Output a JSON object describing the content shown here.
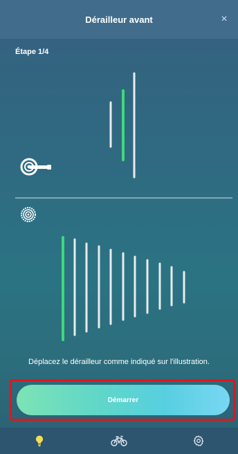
{
  "header": {
    "title": "Dérailleur avant",
    "close_glyph": "×"
  },
  "step": {
    "label": "Étape 1/4"
  },
  "illustration": {
    "crank_icon": "crankset-icon",
    "cassette_icon": "cassette-icon",
    "front_chainrings": 3,
    "front_active": 2,
    "rear_sprockets": 11,
    "rear_active": 1,
    "colors": {
      "active": "#3fd97a",
      "inactive": "#e9ecef",
      "divider": "#d7e2ea"
    }
  },
  "instruction": {
    "text": "Déplacez le dérailleur comme indiqué sur l'illustration."
  },
  "start_button": {
    "label": "Démarrer",
    "highlight_color": "#e0161e"
  },
  "tabbar": {
    "tabs": [
      {
        "icon": "lightbulb-icon",
        "active": true,
        "color": "#f2dc5a"
      },
      {
        "icon": "bicycle-icon",
        "active": false
      },
      {
        "icon": "gear-icon",
        "active": false
      }
    ]
  }
}
